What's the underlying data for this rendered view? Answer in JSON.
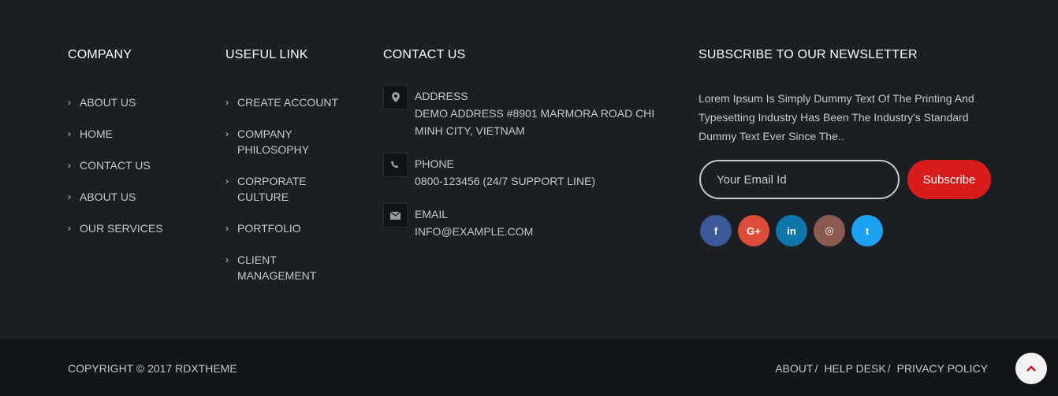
{
  "company": {
    "title": "COMPANY",
    "items": [
      "ABOUT US",
      "HOME",
      "CONTACT US",
      "ABOUT US",
      "OUR SERVICES"
    ]
  },
  "useful": {
    "title": "USEFUL LINK",
    "items": [
      "CREATE ACCOUNT",
      "COMPANY PHILOSOPHY",
      "CORPORATE CULTURE",
      "PORTFOLIO",
      "CLIENT MANAGEMENT"
    ]
  },
  "contact": {
    "title": "CONTACT US",
    "address_label": "ADDRESS",
    "address_value": "DEMO ADDRESS #8901 MARMORA ROAD CHI MINH CITY, VIETNAM",
    "phone_label": "PHONE",
    "phone_value": "0800-123456 (24/7 SUPPORT LINE)",
    "email_label": "EMAIL",
    "email_value": "INFO@EXAMPLE.COM",
    "icons": [
      "map-marker-icon",
      "phone-icon",
      "envelope-icon"
    ]
  },
  "newsletter": {
    "title": "SUBSCRIBE TO OUR NEWSLETTER",
    "text": "Lorem Ipsum Is Simply Dummy Text Of The Printing And Typesetting Industry Has Been The Industry's Standard Dummy Text Ever Since The..",
    "email_placeholder": "Your Email Id",
    "subscribe_label": "Subscribe"
  },
  "social": [
    {
      "name": "facebook-icon",
      "glyph": "f",
      "color": "#3b5998"
    },
    {
      "name": "google-plus-icon",
      "glyph": "G+",
      "color": "#dd4b39"
    },
    {
      "name": "linkedin-icon",
      "glyph": "in",
      "color": "#0e76a8"
    },
    {
      "name": "instagram-icon",
      "glyph": "◎",
      "color": "#8a5a4e"
    },
    {
      "name": "twitter-icon",
      "glyph": "t",
      "color": "#1da1f2"
    }
  ],
  "bottom": {
    "copyright": "COPYRIGHT © 2017 RDXTHEME",
    "links": [
      "ABOUT",
      "HELP DESK",
      "PRIVACY POLICY"
    ],
    "separator": "/"
  },
  "colors": {
    "background": "#1b1f24",
    "bottom_bar": "#131619",
    "accent": "#d81b1b",
    "scroll_top_arrow": "#c0141b"
  },
  "scroll_top_icon": "chevron-up-icon"
}
